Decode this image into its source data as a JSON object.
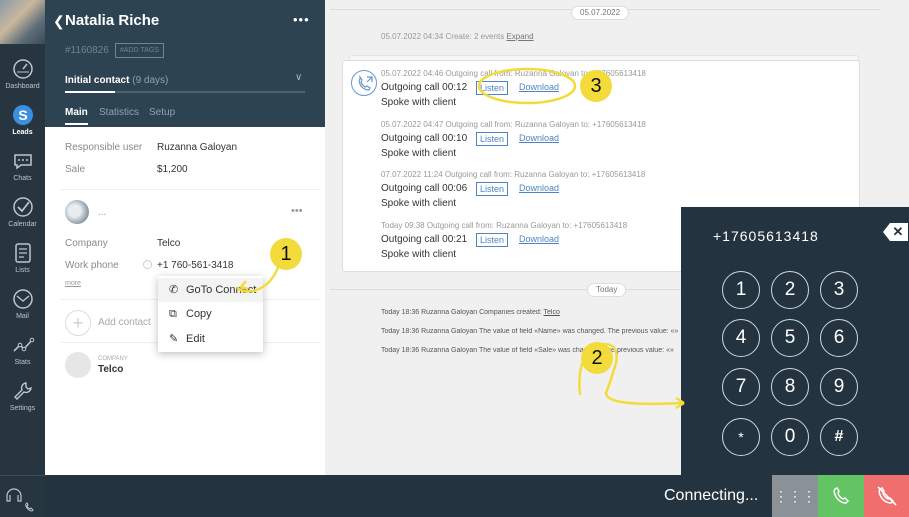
{
  "nav": {
    "items": [
      {
        "label": "Dashboard",
        "icon": "dashboard-icon"
      },
      {
        "label": "Leads",
        "icon": "leads-icon",
        "active": true
      },
      {
        "label": "Chats",
        "icon": "chats-icon"
      },
      {
        "label": "Calendar",
        "icon": "calendar-icon"
      },
      {
        "label": "Lists",
        "icon": "lists-icon"
      },
      {
        "label": "Mail",
        "icon": "mail-icon"
      },
      {
        "label": "Stats",
        "icon": "stats-icon"
      },
      {
        "label": "Settings",
        "icon": "settings-icon"
      }
    ]
  },
  "lead": {
    "name": "Natalia Riche",
    "id": "#1160826",
    "add_tags": "#ADD TAGS",
    "stage": "Initial contact",
    "stage_days": "(9 days)",
    "tabs": [
      "Main",
      "Statistics",
      "Setup"
    ],
    "fields": [
      {
        "label": "Responsible user",
        "value": "Ruzanna Galoyan"
      },
      {
        "label": "Sale",
        "value": "$1,200"
      }
    ],
    "contact_name": "...",
    "contact_fields": [
      {
        "label": "Company",
        "value": "Telco"
      },
      {
        "label": "Work phone",
        "value": "+1 760-561-3418"
      }
    ],
    "more": "more",
    "add_contact": "Add contact",
    "company_caption": "COMPANY",
    "company_name": "Telco"
  },
  "context_menu": {
    "items": [
      {
        "label": "GoTo Connect",
        "icon": "phone-icon"
      },
      {
        "label": "Copy",
        "icon": "copy-icon"
      },
      {
        "label": "Edit",
        "icon": "pencil-icon"
      }
    ]
  },
  "feed": {
    "date_top": "05.07.2022",
    "create_line": "05.07.2022 04:34 Create: 2 events",
    "expand": "Expand",
    "calls": [
      {
        "meta": "05.07.2022 04:46 Outgoing call from: Ruzanna Galoyan to: +17605613418",
        "title": "Outgoing call 00:12",
        "note": "Spoke with client"
      },
      {
        "meta": "05.07.2022 04:47 Outgoing call from: Ruzanna Galoyan to: +17605613418",
        "title": "Outgoing call 00:10",
        "note": "Spoke with client"
      },
      {
        "meta": "07.07.2022 11:24 Outgoing call from: Ruzanna Galoyan to: +17605613418",
        "title": "Outgoing call 00:06",
        "note": "Spoke with client"
      },
      {
        "meta": "Today 09:38 Outgoing call from: Ruzanna Galoyan to: +17605613418",
        "title": "Outgoing call 00:21",
        "note": "Spoke with client"
      }
    ],
    "listen": "Listen",
    "download": "Download",
    "date_today": "Today",
    "sys_lines": [
      {
        "text": "Today 18:36 Ruzanna Galoyan Companies created: ",
        "link": "Telco"
      },
      {
        "text": "Today 18:36 Ruzanna Galoyan The value of field «Name» was changed. The previous value: «»",
        "link": ""
      },
      {
        "text": "Today 18:36 Ruzanna Galoyan The value of field «Sale» was changed. The previous value: «»",
        "link": ""
      }
    ]
  },
  "dialpad": {
    "number": "+17605613418",
    "keys": [
      "1",
      "2",
      "3",
      "4",
      "5",
      "6",
      "7",
      "8",
      "9",
      "*",
      "0",
      "#"
    ]
  },
  "bottom": {
    "status": "Connecting..."
  },
  "annotations": [
    "1",
    "2",
    "3"
  ],
  "colors": {
    "sidebar": "#26353f",
    "lead_header": "#2e4352",
    "link_blue": "#4f84c3",
    "accept": "#62c462",
    "decline": "#f06e6e",
    "annotation": "#f4db3c"
  }
}
